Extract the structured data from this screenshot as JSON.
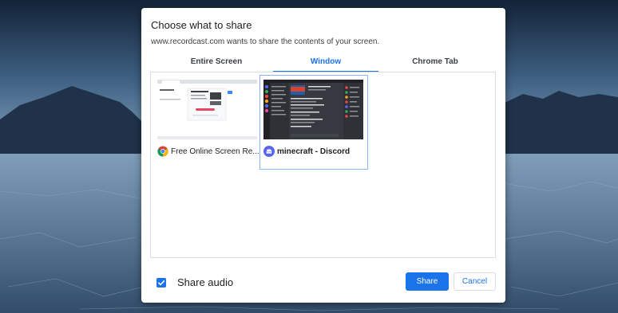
{
  "dialog": {
    "title": "Choose what to share",
    "subtitle": "www.recordcast.com wants to share the contents of your screen."
  },
  "tabs": [
    {
      "label": "Entire Screen",
      "active": false
    },
    {
      "label": "Window",
      "active": true
    },
    {
      "label": "Chrome Tab",
      "active": false
    }
  ],
  "sources": [
    {
      "label": "Free Online Screen Re...",
      "icon": "chrome-icon",
      "selected": false
    },
    {
      "label": "minecraft - Discord",
      "icon": "discord-icon",
      "selected": true
    }
  ],
  "share_audio": {
    "label": "Share audio",
    "checked": true
  },
  "buttons": {
    "share": "Share",
    "cancel": "Cancel"
  },
  "colors": {
    "accent": "#1a73e8",
    "selected_border": "#8ab4f8",
    "discord": "#5865f2"
  }
}
